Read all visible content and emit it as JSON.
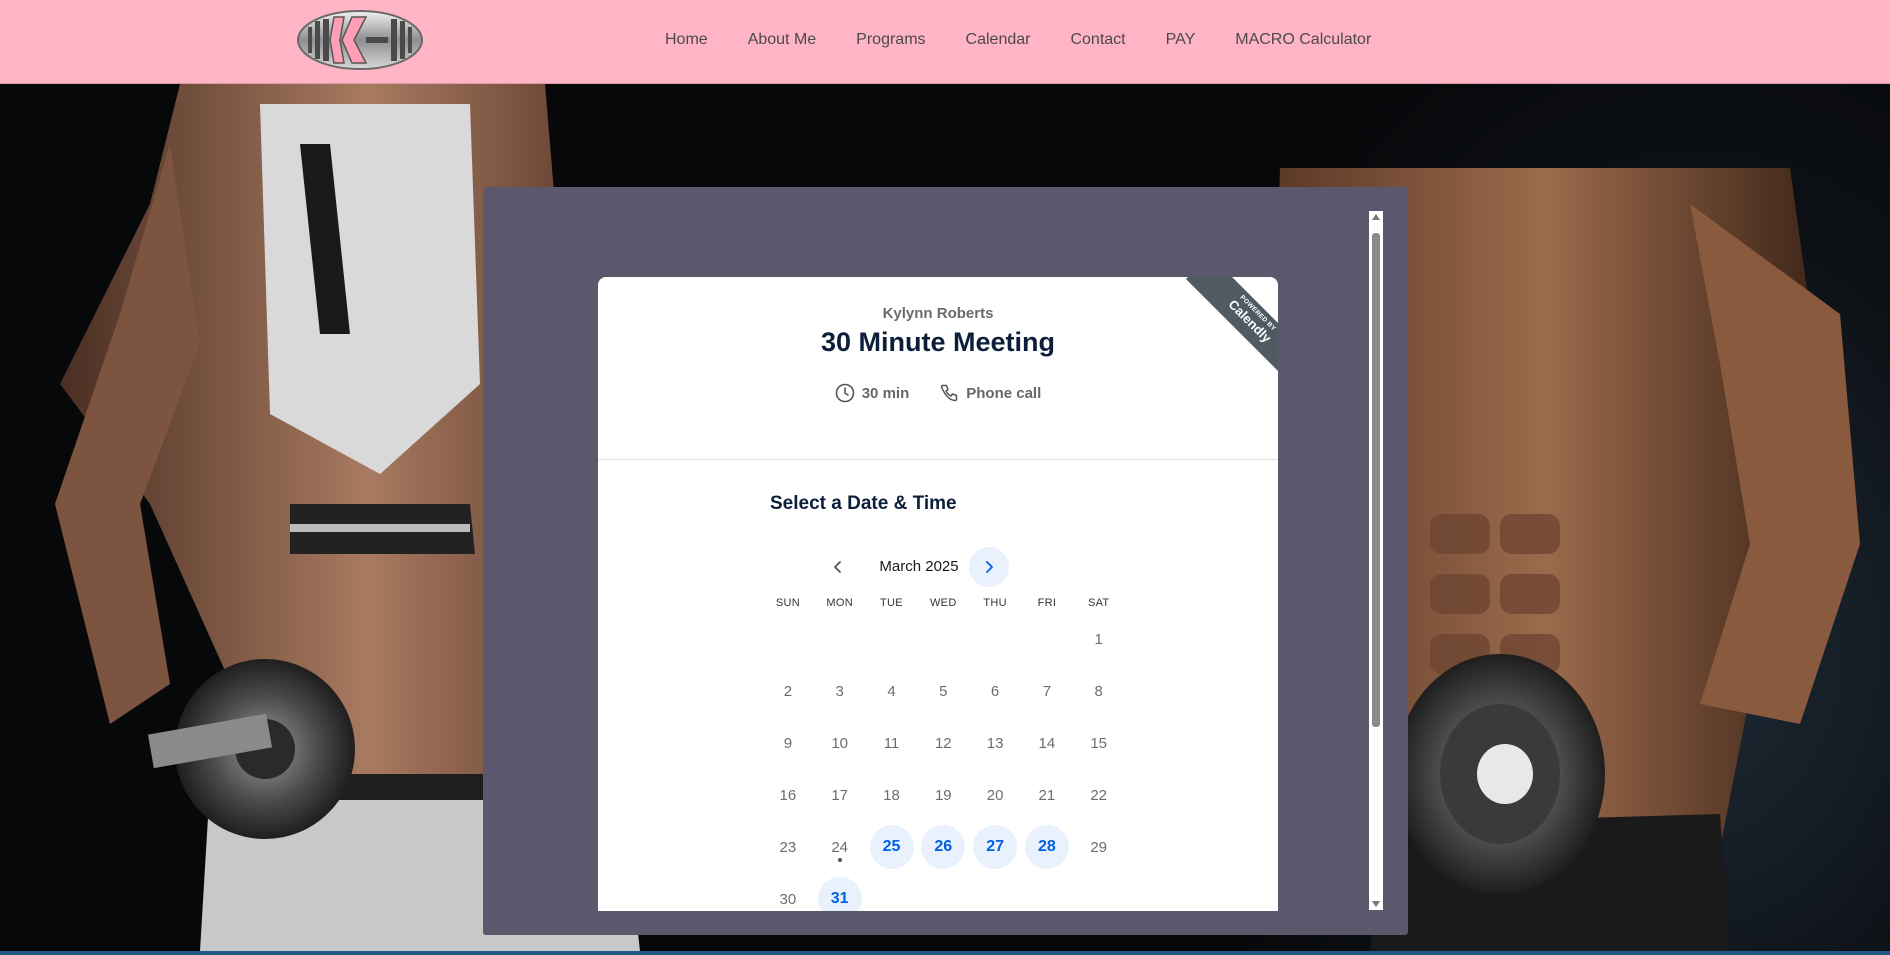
{
  "nav": {
    "logo_icon": "kk-dumbbell-logo-icon",
    "items": [
      "Home",
      "About Me",
      "Programs",
      "Calendar",
      "Contact",
      "PAY",
      "MACRO Calculator"
    ]
  },
  "colors": {
    "nav_bg": "#ffb5c5",
    "embed_bg": "#5b576d",
    "heading": "#0b1f3a",
    "accent_blue": "#0060e6",
    "available_bg": "#e9f1fc"
  },
  "badge": {
    "powered_by": "POWERED BY",
    "brand": "Calendly"
  },
  "event": {
    "host": "Kylynn Roberts",
    "title": "30 Minute Meeting",
    "duration": "30 min",
    "duration_icon": "clock-icon",
    "location": "Phone call",
    "location_icon": "phone-icon"
  },
  "scheduler": {
    "heading": "Select a Date & Time",
    "month": "March 2025",
    "prev_icon": "chevron-left-icon",
    "next_icon": "chevron-right-icon",
    "weekdays": [
      "SUN",
      "MON",
      "TUE",
      "WED",
      "THU",
      "FRI",
      "SAT"
    ],
    "days": [
      {
        "d": "1",
        "col": 6,
        "row": 0
      },
      {
        "d": "2",
        "col": 0,
        "row": 1
      },
      {
        "d": "3",
        "col": 1,
        "row": 1
      },
      {
        "d": "4",
        "col": 2,
        "row": 1
      },
      {
        "d": "5",
        "col": 3,
        "row": 1
      },
      {
        "d": "6",
        "col": 4,
        "row": 1
      },
      {
        "d": "7",
        "col": 5,
        "row": 1
      },
      {
        "d": "8",
        "col": 6,
        "row": 1
      },
      {
        "d": "9",
        "col": 0,
        "row": 2
      },
      {
        "d": "10",
        "col": 1,
        "row": 2
      },
      {
        "d": "11",
        "col": 2,
        "row": 2
      },
      {
        "d": "12",
        "col": 3,
        "row": 2
      },
      {
        "d": "13",
        "col": 4,
        "row": 2
      },
      {
        "d": "14",
        "col": 5,
        "row": 2
      },
      {
        "d": "15",
        "col": 6,
        "row": 2
      },
      {
        "d": "16",
        "col": 0,
        "row": 3
      },
      {
        "d": "17",
        "col": 1,
        "row": 3
      },
      {
        "d": "18",
        "col": 2,
        "row": 3
      },
      {
        "d": "19",
        "col": 3,
        "row": 3
      },
      {
        "d": "20",
        "col": 4,
        "row": 3
      },
      {
        "d": "21",
        "col": 5,
        "row": 3
      },
      {
        "d": "22",
        "col": 6,
        "row": 3
      },
      {
        "d": "23",
        "col": 0,
        "row": 4
      },
      {
        "d": "24",
        "col": 1,
        "row": 4,
        "today": true
      },
      {
        "d": "25",
        "col": 2,
        "row": 4,
        "available": true
      },
      {
        "d": "26",
        "col": 3,
        "row": 4,
        "available": true
      },
      {
        "d": "27",
        "col": 4,
        "row": 4,
        "available": true
      },
      {
        "d": "28",
        "col": 5,
        "row": 4,
        "available": true
      },
      {
        "d": "29",
        "col": 6,
        "row": 4
      },
      {
        "d": "30",
        "col": 0,
        "row": 5
      },
      {
        "d": "31",
        "col": 1,
        "row": 5,
        "available": true
      }
    ]
  }
}
